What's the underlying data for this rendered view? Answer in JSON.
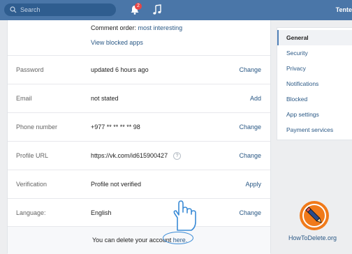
{
  "header": {
    "search_placeholder": "Search",
    "notification_count": "2",
    "user_name": "Tente"
  },
  "settings": {
    "comment_order_label": "Comment order:",
    "comment_order_value": "most interesting",
    "view_blocked_apps": "View blocked apps",
    "rows": [
      {
        "label": "Password",
        "value": "updated 6 hours ago",
        "action": "Change"
      },
      {
        "label": "Email",
        "value": "not stated",
        "action": "Add"
      },
      {
        "label": "Phone number",
        "value": "+977 ** ** ** ** 98",
        "action": "Change"
      },
      {
        "label": "Profile URL",
        "value": "https://vk.com/id615900427",
        "help": "?",
        "action": "Change"
      },
      {
        "label": "Verification",
        "value": "Profile not verified",
        "action": "Apply"
      },
      {
        "label": "Language:",
        "value": "English",
        "action": "Change"
      }
    ],
    "delete_text": "You can delete your account",
    "delete_link": "here."
  },
  "sidebar": {
    "items": [
      {
        "label": "General"
      },
      {
        "label": "Security"
      },
      {
        "label": "Privacy"
      },
      {
        "label": "Notifications"
      },
      {
        "label": "Blocked"
      },
      {
        "label": "App settings"
      },
      {
        "label": "Payment services"
      }
    ]
  },
  "watermark": {
    "text": "HowToDelete.org"
  },
  "colors": {
    "header": "#4a76a8",
    "link": "#2a5885",
    "badge": "#e64646",
    "logo_orange": "#f07a1a"
  }
}
